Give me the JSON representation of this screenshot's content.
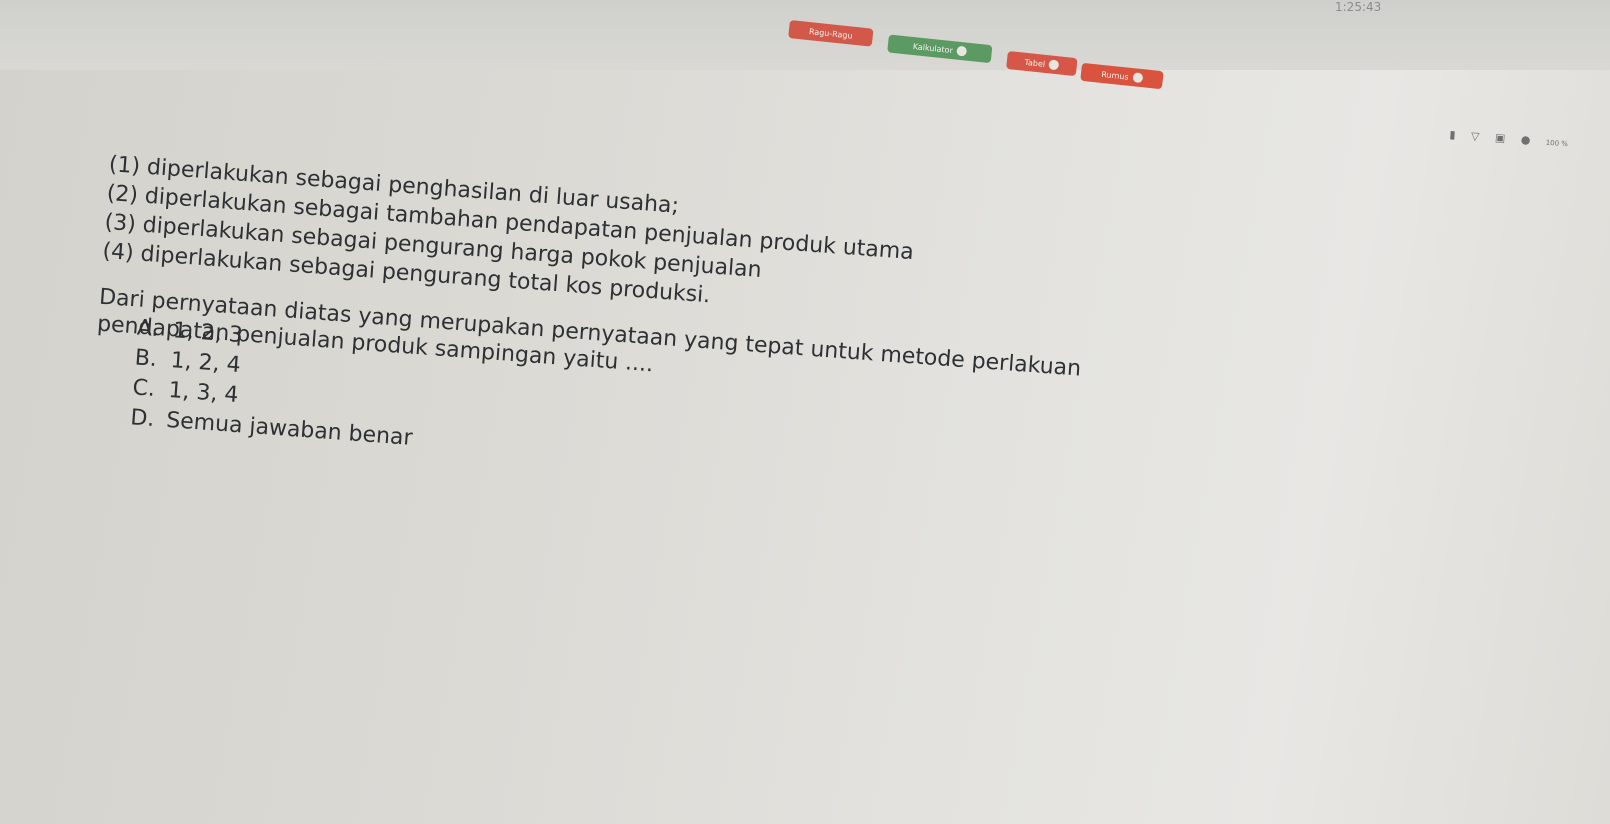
{
  "clock": "1:25:43",
  "toolbar": {
    "btn1": "Ragu-Ragu",
    "btn2": "Kalkulator",
    "btn3": "Tabel",
    "btn4": "Rumus"
  },
  "status_icons": [
    "battery",
    "wifi",
    "volume",
    "sound"
  ],
  "status_text": "100 %",
  "statements": [
    "(1) diperlakukan sebagai penghasilan di luar usaha;",
    "(2) diperlakukan sebagai tambahan pendapatan penjualan produk utama",
    "(3) diperlakukan sebagai pengurang harga pokok penjualan",
    "(4) diperlakukan sebagai pengurang total kos produksi."
  ],
  "question": {
    "line1": "Dari pernyataan diatas yang merupakan pernyataan yang tepat untuk metode perlakuan",
    "line2": "pendapatan penjualan produk sampingan yaitu ...."
  },
  "options": [
    {
      "letter": "A.",
      "text": "1, 2, 3"
    },
    {
      "letter": "B.",
      "text": "1, 2, 4"
    },
    {
      "letter": "C.",
      "text": "1, 3, 4"
    },
    {
      "letter": "D.",
      "text": "Semua jawaban benar"
    }
  ],
  "colors": {
    "red_button": "#d2584a",
    "green_button": "#5c9a63",
    "text": "#2e3134"
  }
}
